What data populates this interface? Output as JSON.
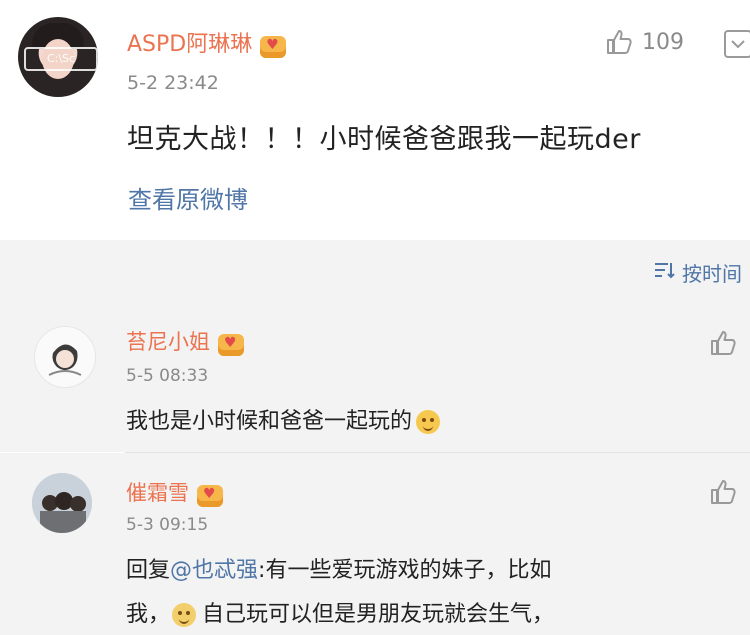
{
  "post": {
    "username": "ASPD阿琳琳",
    "time": "5-2 23:42",
    "likes": "109",
    "text": "坦克大战！！！小时候爸爸跟我一起玩der",
    "view_original": "查看原微博",
    "avatar_watermark": "C:\\Sc"
  },
  "sort": {
    "label": "按时间"
  },
  "comments": [
    {
      "username": "苔尼小姐",
      "time": "5-5 08:33",
      "text": "我也是小时候和爸爸一起玩的"
    },
    {
      "username": "催霜雪",
      "time": "5-3 09:15",
      "reply_prefix": "回复",
      "mention": "@也忒强",
      "text_line1": ":有一些爱玩游戏的妹子，比如",
      "text_line2a": "我，",
      "text_line2b": "自己玩可以但是男朋友玩就会生气，"
    }
  ],
  "colors": {
    "username": "#eb7350",
    "link": "#5076a8",
    "meta": "#8a8a8a",
    "background_alt": "#f3f3f3"
  },
  "icons": {
    "like": "thumbs-up-icon",
    "more": "chevron-down-icon",
    "sort": "sort-icon",
    "vip": "vip-crown-icon",
    "emoji": "smiley-emoji-icon"
  }
}
